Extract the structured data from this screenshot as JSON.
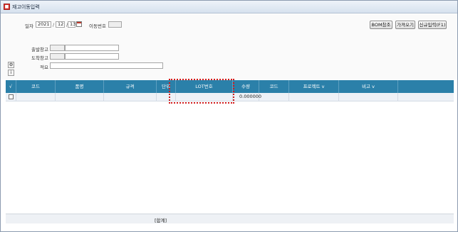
{
  "window": {
    "title": "재고이동입력",
    "icon": "app-window-icon"
  },
  "form": {
    "date_label": "일자",
    "year": "2021",
    "month": "12",
    "day": "13",
    "date_sep": "/",
    "move_no_label": "이동번호",
    "move_no_value": "",
    "from_warehouse_label": "출발창고",
    "from_warehouse_code": "",
    "from_warehouse_name": "",
    "to_warehouse_label": "도착창고",
    "to_warehouse_code": "",
    "to_warehouse_name": "",
    "remark_label": "적요",
    "remark_value": ""
  },
  "toolbar": {
    "bom_label": "BOM참조",
    "fetch_label": "가져오기",
    "new_label": "신규입력(F1)"
  },
  "side": {
    "settings_icon": "gear-icon",
    "info_icon": "info-icon"
  },
  "grid": {
    "headers": [
      "√",
      "코드",
      "품명",
      "규격",
      "단위",
      "LOT번호",
      "수량",
      "코드",
      "프로젝트 v",
      "비고 v",
      ""
    ],
    "rows": [
      {
        "check": "",
        "code": "",
        "name": "",
        "spec": "",
        "unit": "",
        "lot": "",
        "qty": "0.000000",
        "code2": "",
        "project": "",
        "memo": ""
      }
    ]
  },
  "footer": {
    "total_label": "[합계]"
  },
  "colors": {
    "header_bg": "#2b80a9",
    "highlight": "#d11a1a"
  }
}
